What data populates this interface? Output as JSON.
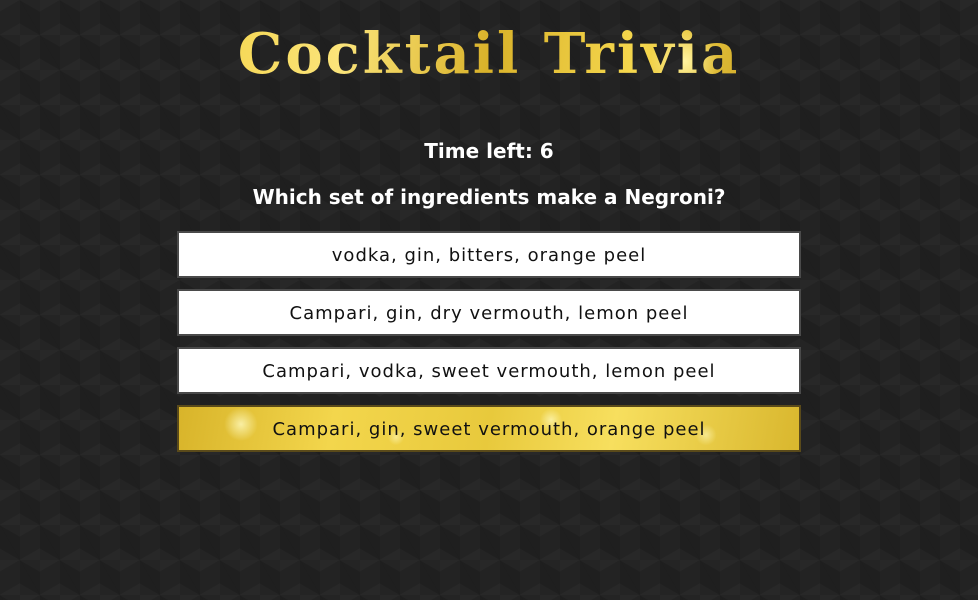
{
  "title": "Cocktail Trivia",
  "timer": {
    "text": "Time left: 6"
  },
  "question": {
    "text": "Which set of ingredients make a Negroni?"
  },
  "answers": [
    {
      "label": "vodka, gin, bitters, orange peel",
      "selected": false
    },
    {
      "label": "Campari, gin, dry vermouth, lemon peel",
      "selected": false
    },
    {
      "label": "Campari, vodka, sweet vermouth, lemon peel",
      "selected": false
    },
    {
      "label": "Campari, gin, sweet vermouth, orange peel",
      "selected": true
    }
  ],
  "colors": {
    "background": "#232323",
    "gold": "#e9c83c",
    "answer_bg": "#ffffff",
    "text": "#ffffff"
  }
}
